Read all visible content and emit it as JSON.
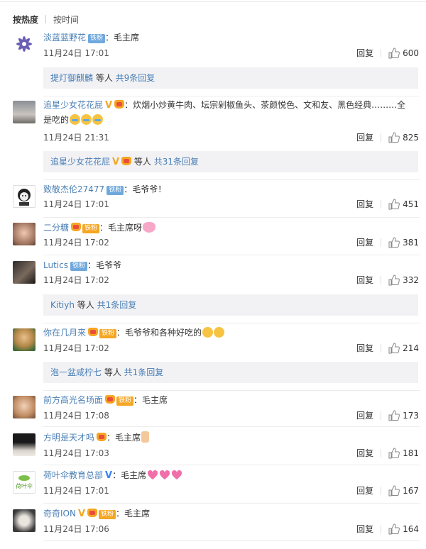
{
  "sort": {
    "hot": "按热度",
    "time": "按时间"
  },
  "actions": {
    "reply": "回复"
  },
  "comments": [
    {
      "user": "淡蓝蓝野花",
      "badge": "铁粉",
      "text": "：毛主席",
      "time": "11月24日 17:01",
      "likes": "600",
      "sub": {
        "name": "提灯御麒麟",
        "mid": " 等人 ",
        "count": "共9条回复"
      }
    },
    {
      "user": "追星少女花花屁",
      "text": "：炊烟小炒黄牛肉、坛宗剁椒鱼头、茶颜悦色、文和友、黑色经典………全",
      "text2": "是吃的",
      "time": "11月24日 21:31",
      "likes": "825",
      "sub": {
        "name": "追星少女花花屁",
        "mid": " 等人 ",
        "count": "共31条回复"
      }
    },
    {
      "user": "致敬杰伦27477",
      "badge": "铁粉",
      "text": "：毛爷爷！",
      "time": "11月24日 17:01",
      "likes": "451"
    },
    {
      "user": "二分糖",
      "badge": "铁粉",
      "text": "：毛主席呀",
      "time": "11月24日 17:02",
      "likes": "381"
    },
    {
      "user": "Lutics",
      "badge": "铁粉",
      "text": "：毛爷爷",
      "time": "11月24日 17:02",
      "likes": "332",
      "sub": {
        "name": "Kitiyh",
        "mid": " 等人 ",
        "count": "共1条回复"
      }
    },
    {
      "user": "你在几月来",
      "badge": "铁粉",
      "text": "：毛爷爷和各种好吃的",
      "time": "11月24日 17:02",
      "likes": "214",
      "sub": {
        "name": "泡一盆咸柠七",
        "mid": " 等人 ",
        "count": "共1条回复"
      }
    },
    {
      "user": "前方高光名场面",
      "badge": "铁粉",
      "text": "：毛主席",
      "time": "11月24日 17:08",
      "likes": "173"
    },
    {
      "user": "方明是天才吗",
      "text": "：毛主席",
      "time": "11月24日 17:03",
      "likes": "181"
    },
    {
      "user": "荷叶伞教育总部",
      "text": "：毛主席",
      "time": "11月24日 17:01",
      "likes": "167"
    },
    {
      "user": "奇奇ION",
      "badge": "铁粉",
      "text": "：毛主席",
      "time": "11月24日 17:06",
      "likes": "164"
    }
  ],
  "avatar_text": {
    "c9": "荷叶伞"
  },
  "colors": {
    "link": "#4a7fb5",
    "badge_fan": "#6fa8dc",
    "badge_gold": "#f5a623",
    "sub_bg": "#f2f2f5"
  },
  "icons": {
    "like": "thumbs-up-icon",
    "verified": "v-icon",
    "member": "crown-icon"
  }
}
